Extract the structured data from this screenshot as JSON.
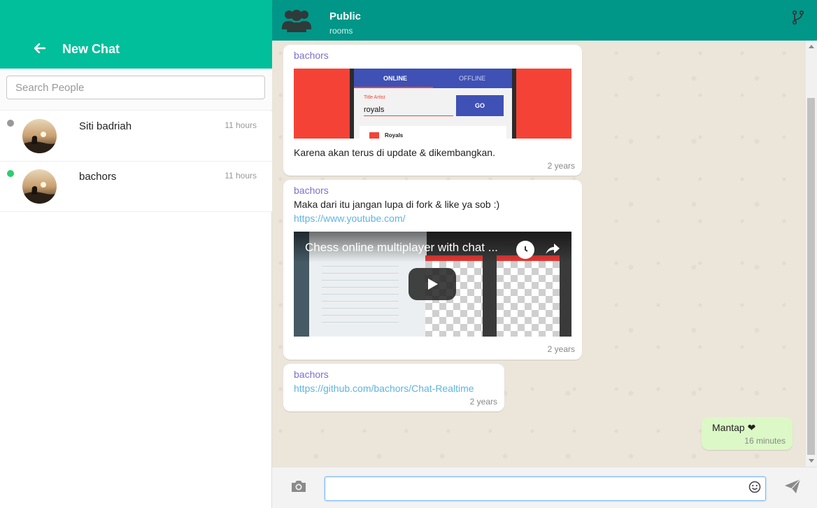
{
  "sidebar": {
    "title": "New Chat",
    "search_placeholder": "Search People",
    "contacts": [
      {
        "name": "Siti badriah",
        "time": "11 hours",
        "status_color": "#999999"
      },
      {
        "name": "bachors",
        "time": "11 hours",
        "status_color": "#2ecc71"
      }
    ]
  },
  "room": {
    "name": "Public",
    "subtitle": "rooms"
  },
  "messages": [
    {
      "sender": "bachors",
      "text": "Karena akan terus di update & dikembangkan.",
      "time": "2 years",
      "image": {
        "tab_online": "ONLINE",
        "tab_offline": "OFFLINE",
        "field_label": "Title Artist",
        "field_value": "royals",
        "go_label": "GO",
        "result_label": "Royals"
      }
    },
    {
      "sender": "bachors",
      "text": "Maka dari itu jangan lupa di fork & like ya sob :)",
      "link": "https://www.youtube.com/",
      "time": "2 years",
      "video": {
        "title": "Chess online multiplayer with chat ..."
      }
    },
    {
      "sender": "bachors",
      "link_prefix": "",
      "link": "https://github.com/bachors/Chat-Realtime",
      "link_suffix": "",
      "time": "2 years"
    },
    {
      "text": "Mantap ❤",
      "time": "16 minutes",
      "own": true
    }
  ],
  "composer": {
    "value": ""
  },
  "colors": {
    "sidebar_header": "#00bf9a",
    "chat_header": "#009688",
    "own_bubble": "#dcf8c6",
    "sender_name": "#7e6fd0"
  }
}
